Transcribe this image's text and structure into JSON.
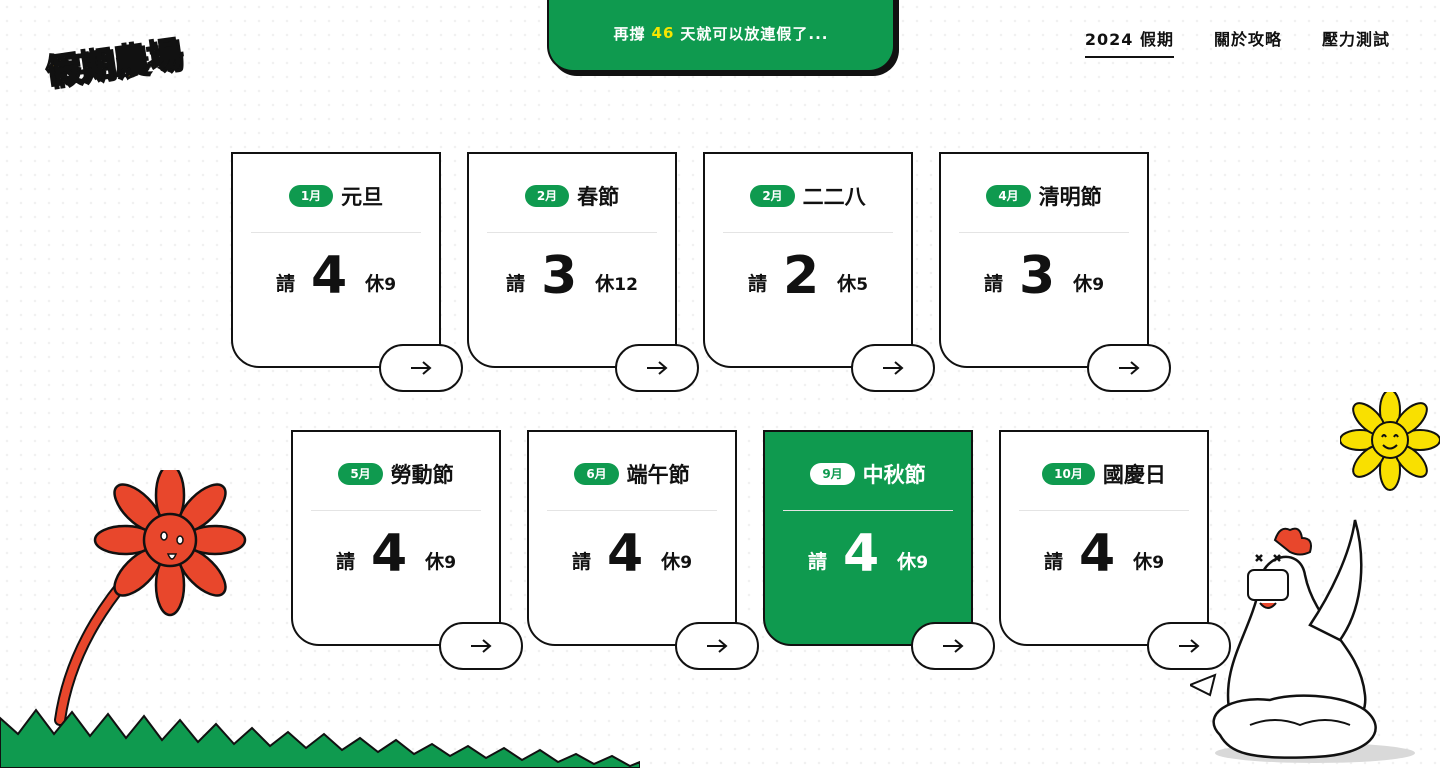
{
  "logo": {
    "text": "假期農場"
  },
  "banner": {
    "prefix": "再撐",
    "days": "46",
    "suffix": "天就可以放連假了..."
  },
  "nav": {
    "items": [
      "2024 假期",
      "關於攻略",
      "壓力測試"
    ]
  },
  "labels": {
    "request": "請",
    "off": "休"
  },
  "cards": [
    {
      "month": "1月",
      "name": "元旦",
      "request": "4",
      "off": "9"
    },
    {
      "month": "2月",
      "name": "春節",
      "request": "3",
      "off": "12"
    },
    {
      "month": "2月",
      "name": "二二八",
      "request": "2",
      "off": "5"
    },
    {
      "month": "4月",
      "name": "清明節",
      "request": "3",
      "off": "9"
    },
    {
      "month": "5月",
      "name": "勞動節",
      "request": "4",
      "off": "9"
    },
    {
      "month": "6月",
      "name": "端午節",
      "request": "4",
      "off": "9"
    },
    {
      "month": "9月",
      "name": "中秋節",
      "request": "4",
      "off": "9"
    },
    {
      "month": "10月",
      "name": "國慶日",
      "request": "4",
      "off": "9"
    }
  ],
  "colors": {
    "accent": "#0f9a4f",
    "highlight": "#f6e600",
    "flower": "#e8472c",
    "sunflower": "#f9e000"
  }
}
